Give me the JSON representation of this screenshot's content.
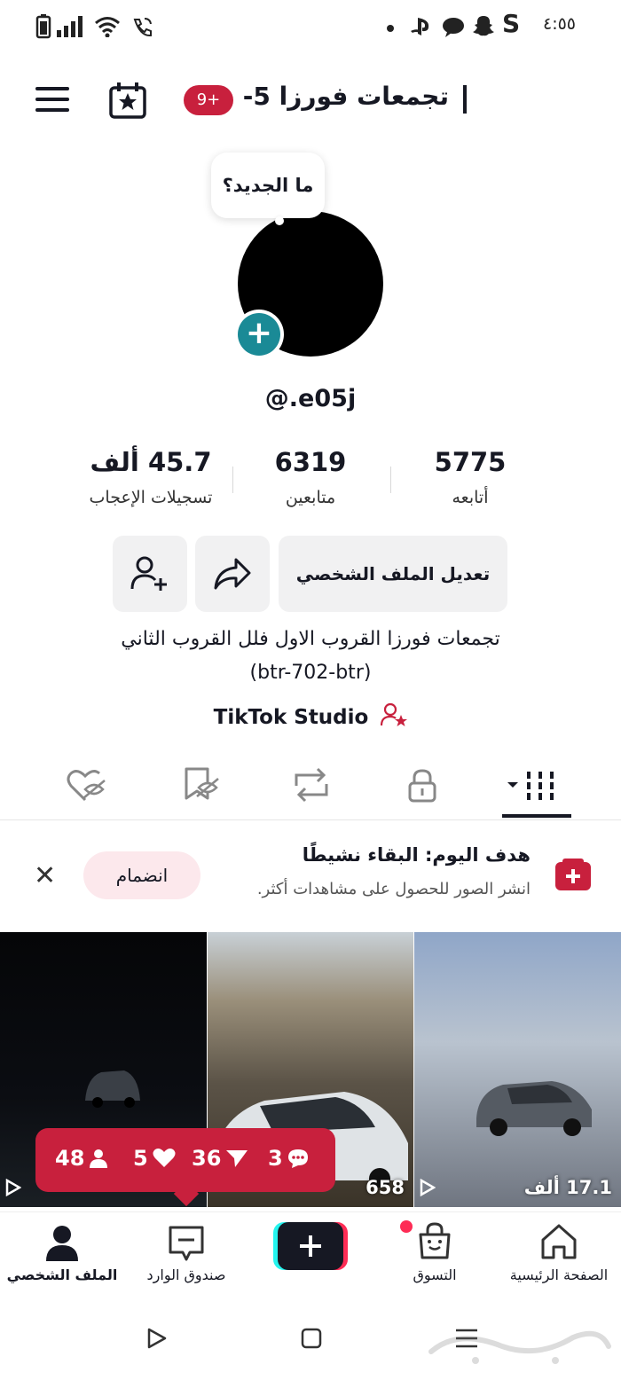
{
  "status_bar": {
    "time": "٤:٥٥",
    "s_label": "S"
  },
  "header": {
    "title": "تجمعات فورزا 5-",
    "badge": "9+"
  },
  "bubble": {
    "text": "ما الجديد؟"
  },
  "profile": {
    "username": "@.e05j",
    "stats": [
      {
        "value": "5775",
        "label": "أتابعه"
      },
      {
        "value": "6319",
        "label": "متابعين"
      },
      {
        "value": "45.7 ألف",
        "label": "تسجيلات الإعجاب"
      }
    ],
    "edit_label": "تعديل الملف الشخصي",
    "bio_line1": "تجمعات فورزا القروب الاول فلل القروب الثاني",
    "bio_line2": "(btr-702-btr)",
    "studio_label": "TikTok Studio"
  },
  "goal": {
    "title": "هدف اليوم: البقاء نشيطًا",
    "subtitle": "انشر الصور للحصول على مشاهدات أكثر.",
    "join_label": "انضمام",
    "close": "✕"
  },
  "videos": [
    {
      "count": "17.1 ألف",
      "colors": [
        "#8fa6c8",
        "#6f7580"
      ]
    },
    {
      "count": "658",
      "colors": [
        "#9a8f7a",
        "#3a3328"
      ]
    },
    {
      "count": "",
      "colors": [
        "#0b0d12",
        "#1a1f24"
      ]
    }
  ],
  "popup_stats": {
    "comments": "3",
    "shares": "36",
    "likes": "5",
    "followers": "48"
  },
  "bottom_nav": {
    "home": "الصفحة الرئيسية",
    "shop": "التسوق",
    "inbox": "صندوق الوارد",
    "profile": "الملف الشخصي"
  },
  "colors": {
    "brand_red": "#c8203d",
    "add_teal": "#1a8a96"
  }
}
